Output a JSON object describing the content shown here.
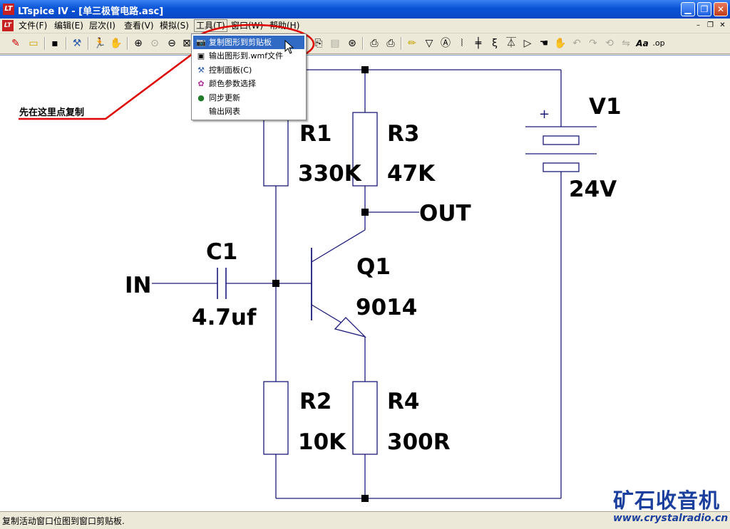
{
  "window": {
    "title": "LTspice IV - [单三极管电路.asc]",
    "app_icon": "LT",
    "buttons": {
      "minimize": "▁",
      "restore": "❐",
      "close": "✕"
    }
  },
  "menubar": {
    "items": [
      "文件(F)",
      "编辑(E)",
      "层次(I)",
      "查看(V)",
      "模拟(S)",
      "工具(T)",
      "窗口(W)",
      "帮助(H)"
    ],
    "active_index": 5,
    "mdi_buttons": {
      "minimize": "–",
      "restore": "❐",
      "close": "✕"
    }
  },
  "toolbar": {
    "icons": [
      "new-schematic-icon",
      "open-icon",
      "save-icon",
      "control-panel-icon",
      "run-icon",
      "halt-icon",
      "zoom-in-icon",
      "pan-icon",
      "zoom-out-icon",
      "zoom-fit-icon",
      "copy-icon",
      "paste-icon",
      "find-icon",
      "print-setup-icon",
      "print-icon",
      "draw-wire-icon",
      "ground-icon",
      "label-net-icon",
      "resistor-icon",
      "capacitor-icon",
      "inductor-icon",
      "diode-icon",
      "component-icon",
      "move-icon",
      "drag-icon",
      "undo-icon",
      "redo-icon",
      "rotate-icon",
      "mirror-icon",
      "text-icon",
      "spice-directive-icon"
    ]
  },
  "tools_menu": {
    "items": [
      {
        "label": "复制图形到剪贴板",
        "icon": "camera-icon",
        "highlighted": true
      },
      {
        "label": "输出图形到.wmf文件",
        "icon": "export-icon",
        "highlighted": false
      },
      {
        "label": "控制面板(C)",
        "icon": "hammer-icon",
        "highlighted": false
      },
      {
        "label": "颜色参数选择",
        "icon": "palette-icon",
        "highlighted": false
      },
      {
        "label": "同步更新",
        "icon": "globe-icon",
        "highlighted": false
      },
      {
        "label": "输出网表",
        "icon": "",
        "highlighted": false
      }
    ]
  },
  "annotation": {
    "text": "先在这里点复制",
    "color": "#e00000"
  },
  "schematic": {
    "components": [
      {
        "ref": "R1",
        "value": "330K"
      },
      {
        "ref": "R3",
        "value": "47K"
      },
      {
        "ref": "R2",
        "value": "10K"
      },
      {
        "ref": "R4",
        "value": "300R"
      },
      {
        "ref": "C1",
        "value": "4.7uf"
      },
      {
        "ref": "Q1",
        "value": "9014"
      },
      {
        "ref": "V1",
        "value": "24V"
      }
    ],
    "net_labels": {
      "input": "IN",
      "output": "OUT"
    },
    "battery_plus": "+",
    "wire_color": "#1a1a7a"
  },
  "statusbar": {
    "text": "复制活动窗口位图到窗口剪贴板."
  },
  "watermark": {
    "text": "矿石收音机",
    "url": "www.crystalradio.cn"
  }
}
